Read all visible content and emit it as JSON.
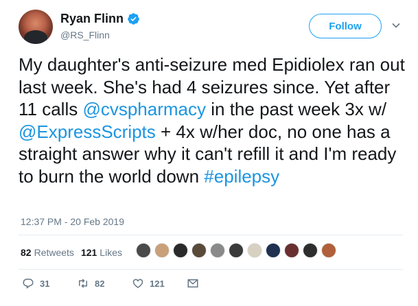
{
  "author": {
    "name": "Ryan Flinn",
    "handle": "@RS_Flinn",
    "verified": true
  },
  "follow_button": {
    "label": "Follow"
  },
  "tweet": {
    "segments": [
      {
        "text": "My daughter's anti-seizure med Epidiolex ran out last week. She's had 4 seizures since. Yet after 11 calls ",
        "type": "text"
      },
      {
        "text": "@cvspharmacy",
        "type": "mention"
      },
      {
        "text": " in the past week 3x w/ ",
        "type": "text"
      },
      {
        "text": "@ExpressScripts",
        "type": "mention"
      },
      {
        "text": " + 4x w/her doc, no one has a straight answer why it can't refill it and I'm ready to burn the world down ",
        "type": "text"
      },
      {
        "text": "#epilepsy",
        "type": "hashtag"
      }
    ],
    "timestamp": "12:37 PM - 20 Feb 2019"
  },
  "stats": {
    "retweets_count": "82",
    "retweets_label": "Retweets",
    "likes_count": "121",
    "likes_label": "Likes"
  },
  "liker_avatars": [
    {
      "name": "liker-avatar-1",
      "color": "#4a4a4a"
    },
    {
      "name": "liker-avatar-2",
      "color": "#c9a07a"
    },
    {
      "name": "liker-avatar-3",
      "color": "#2a2a2a"
    },
    {
      "name": "liker-avatar-4",
      "color": "#5a4a3a"
    },
    {
      "name": "liker-avatar-5",
      "color": "#8a8a8a"
    },
    {
      "name": "liker-avatar-6",
      "color": "#3a3a3a"
    },
    {
      "name": "liker-avatar-7",
      "color": "#d8d0c0"
    },
    {
      "name": "liker-avatar-8",
      "color": "#1f3050"
    },
    {
      "name": "liker-avatar-9",
      "color": "#6a3030"
    },
    {
      "name": "liker-avatar-10",
      "color": "#2e2e2e"
    },
    {
      "name": "liker-avatar-11",
      "color": "#b0603a"
    }
  ],
  "actions": {
    "reply_count": "31",
    "retweet_count": "82",
    "like_count": "121"
  },
  "colors": {
    "accent": "#1da1f2",
    "link": "#1b95e0",
    "secondary_text": "#657786",
    "divider": "#e6ecf0"
  }
}
